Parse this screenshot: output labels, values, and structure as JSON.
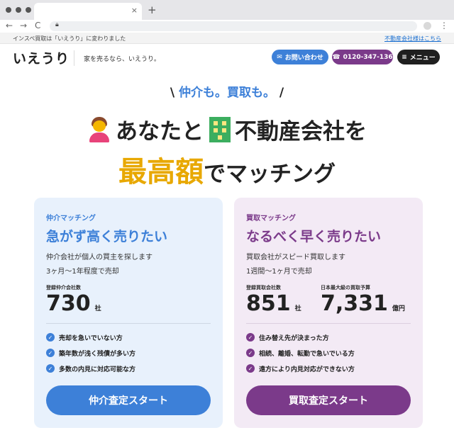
{
  "browser": {
    "tab_close": "×",
    "new_tab": "+",
    "back": "←",
    "forward": "→",
    "reload": "C",
    "menu": "⋮"
  },
  "notice": {
    "message": "インスペ買取は「いえうり」に変わりました",
    "link": "不動産会社様はこちら"
  },
  "header": {
    "logo": "いえうり",
    "tagline": "家を売るなら、いえうり。",
    "contact_label": "お問い合わせ",
    "phone_label": "0120-347-136",
    "menu_label": "メニュー",
    "icons": {
      "contact": "mail-icon",
      "phone": "phone-icon",
      "menu": "hamburger-icon"
    }
  },
  "hero": {
    "catch": "仲介も。買取も。",
    "line1_a": "あなたと",
    "line1_b": "不動産会社を",
    "line2_strong": "最高額",
    "line2_rest": "でマッチング",
    "icons": {
      "person": "person-icon",
      "building": "building-icon"
    }
  },
  "cards": [
    {
      "label": "仲介マッチング",
      "title": "急がず高く売りたい",
      "desc1": "仲介会社が個人の買主を探します",
      "desc2": "3ヶ月〜1年程度で売却",
      "stats": [
        {
          "label": "登録仲介会社数",
          "value": "730",
          "unit": "社"
        }
      ],
      "points": [
        "売却を急いでいない方",
        "築年数が浅く残債が多い方",
        "多数の内見に対応可能な方"
      ],
      "button": "仲介査定スタート",
      "accent": "#3d80d8"
    },
    {
      "label": "買取マッチング",
      "title": "なるべく早く売りたい",
      "desc1": "買取会社がスピード買取します",
      "desc2": "1週間〜1ヶ月で売却",
      "stats": [
        {
          "label": "登録買取会社数",
          "value": "851",
          "unit": "社"
        },
        {
          "label": "日本最大級の買取予算",
          "value": "7,331",
          "unit": "億円"
        }
      ],
      "points": [
        "住み替え先が決まった方",
        "相続、離婚、転勤で急いでいる方",
        "遠方により内見対応ができない方"
      ],
      "button": "買取査定スタート",
      "accent": "#7b3a8a"
    }
  ]
}
